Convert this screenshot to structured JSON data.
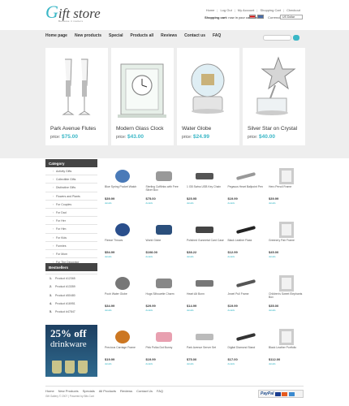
{
  "header": {
    "logo_first": "G",
    "logo_rest": "ift store",
    "logo_tagline": "Because it matters",
    "top_links": [
      "Home",
      "Log Out",
      "My Account",
      "Shopping Cart",
      "Checkout"
    ],
    "cart_label": "Shopping cart:",
    "cart_text": "now in your cart",
    "cart_count": "0 items",
    "currency_label": "Currencies",
    "currency_value": "US Dollar"
  },
  "nav": {
    "items": [
      "Home page",
      "New products",
      "Special",
      "Products all",
      "Reviews",
      "Contact us",
      "FAQ"
    ],
    "search_placeholder": ""
  },
  "featured": [
    {
      "name": "Park Avenue Flutes",
      "price_label": "price:",
      "price": "$75.00"
    },
    {
      "name": "Modern Glass Clock",
      "price_label": "price:",
      "price": "$43.00"
    },
    {
      "name": "Water Globe",
      "price_label": "price:",
      "price": "$24.99"
    },
    {
      "name": "Silver Star on Crystal",
      "price_label": "price:",
      "price": "$40.00"
    }
  ],
  "sidebar": {
    "category_title": "Category",
    "categories": [
      "Activity Gifts",
      "Collectible Gifts",
      "Distinctive Gifts",
      "Flowers and Plants",
      "For Couples",
      "For Dad",
      "For Her",
      "For Him",
      "For Kids",
      "Funnies",
      "For Mom",
      "For The Decorator",
      "For The Entertainer"
    ],
    "bestsellers_title": "Bestsellers",
    "bestsellers": [
      "Product #12365",
      "Product #13359",
      "Product #50480",
      "Product #16951",
      "Product #47847"
    ],
    "promo_line1": "25% off",
    "promo_line2": "drinkware"
  },
  "products": [
    {
      "name": "Blue Spring Pocket Watch",
      "price": "$39.99",
      "icon": "pocket-watch-icon",
      "color": "#4a7ab8"
    },
    {
      "name": "Sterling Cufflinks with Free Silver Box",
      "price": "$75.00",
      "icon": "cufflinks-icon",
      "color": "#999999"
    },
    {
      "name": "1 GB Swiss USB Key Chain",
      "price": "$25.95",
      "icon": "usb-key-icon",
      "color": "#555555"
    },
    {
      "name": "Pegasus Heart Ballpoint Pen",
      "price": "$19.99",
      "icon": "pen-icon",
      "color": "#999999"
    },
    {
      "name": "Hero Pencil Frame",
      "price": "$39.99",
      "icon": "frame-icon",
      "color": "#bbbbbb"
    },
    {
      "name": "Fleece Throws",
      "price": "$54.99",
      "icon": "throw-blanket-icon",
      "color": "#2a4f8c"
    },
    {
      "name": "World Globe",
      "price": "$108.00",
      "icon": "globe-icon",
      "color": "#2b4f7c"
    },
    {
      "name": "Polished Gunmetal Card Case",
      "price": "$38.22",
      "icon": "card-case-icon",
      "color": "#444444"
    },
    {
      "name": "Black Leather Flask",
      "price": "$12.99",
      "icon": "flask-icon",
      "color": "#222222"
    },
    {
      "name": "Greenery Pair Frame",
      "price": "$45.00",
      "icon": "pair-frame-icon",
      "color": "#bbbbbb"
    },
    {
      "name": "Pooh Water Globe",
      "price": "$34.99",
      "icon": "water-globe-icon",
      "color": "#777777"
    },
    {
      "name": "Hugs Silhouette Charm",
      "price": "$29.99",
      "icon": "charm-icon",
      "color": "#888888"
    },
    {
      "name": "Heart Alt Bonn",
      "price": "$14.99",
      "icon": "watch-icon",
      "color": "#777777"
    },
    {
      "name": "Jewel Pull Frame",
      "price": "$19.99",
      "icon": "jewel-icon",
      "color": "#555555"
    },
    {
      "name": "Children's Sweet Elephants Box",
      "price": "$35.00",
      "icon": "keepsake-box-icon",
      "color": "#aaaaaa"
    },
    {
      "name": "Precious Carriage Frame",
      "price": "$19.99",
      "icon": "carriage-frame-icon",
      "color": "#cc7722"
    },
    {
      "name": "Pink Polka Dot Bunny",
      "price": "$19.99",
      "icon": "bunny-icon",
      "color": "#e8a0b0"
    },
    {
      "name": "Park Avenue Server Set",
      "price": "$75.00",
      "icon": "server-set-icon",
      "color": "#bbbbbb"
    },
    {
      "name": "Digital Diamond Stand",
      "price": "$17.00",
      "icon": "desk-stand-icon",
      "color": "#333333"
    },
    {
      "name": "Black Leather Portfolio",
      "price": "$112.00",
      "icon": "portfolio-icon",
      "color": "#222222"
    }
  ],
  "product_details_label": "details",
  "footer": {
    "links": [
      "Home",
      "New Products",
      "Specials",
      "All Products",
      "Reviews",
      "Contact Us",
      "FAQ"
    ],
    "copyright": "Gift Gallery © 2007 | Powered by Bits Cart",
    "payment_label": "PayPal"
  },
  "colors": {
    "accent": "#3ab7c6",
    "dark": "#444444",
    "band": "#eeeeee"
  }
}
